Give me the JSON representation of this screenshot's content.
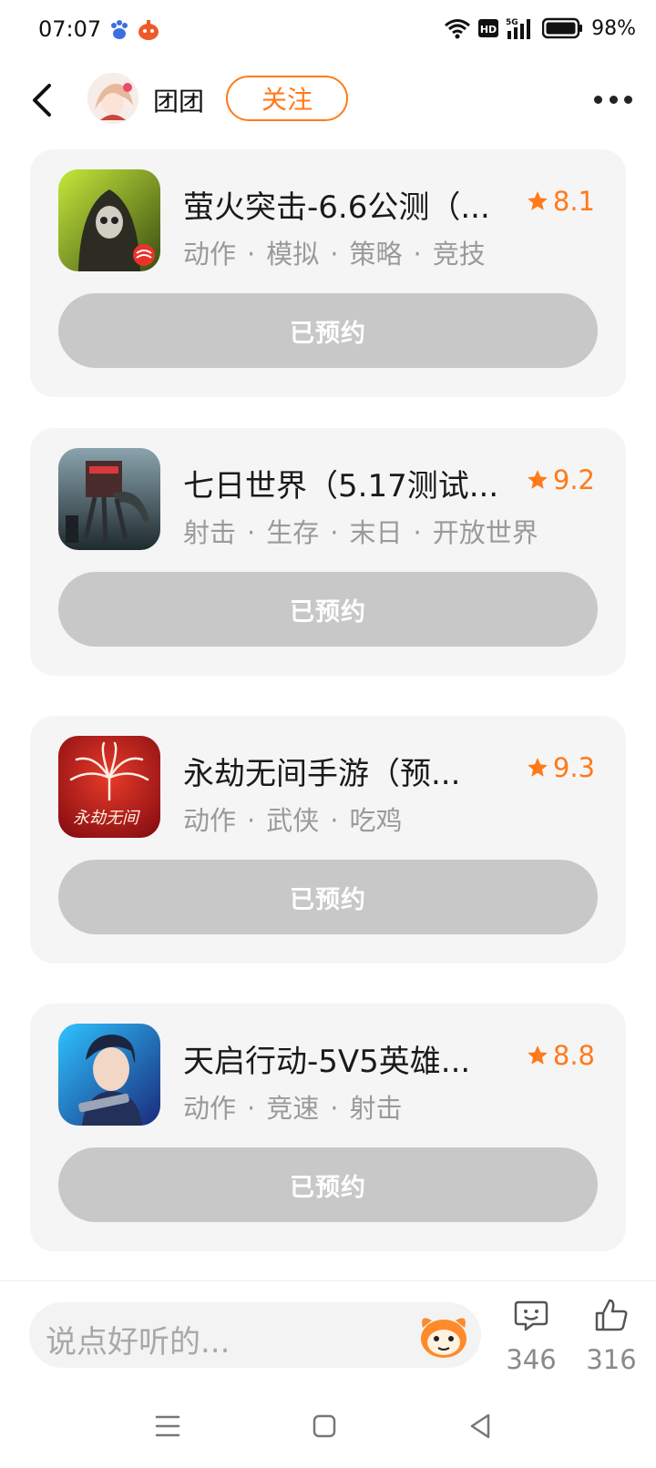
{
  "status_bar": {
    "time": "07:07",
    "battery": "98%",
    "hd_label": "HD",
    "net_label": "5G"
  },
  "header": {
    "username": "团团",
    "follow_label": "关注"
  },
  "games": [
    {
      "title": "萤火突击-6.6公测（...",
      "rating": "8.1",
      "tags": [
        "动作",
        "模拟",
        "策略",
        "竞技"
      ],
      "button": "已预约"
    },
    {
      "title": "七日世界（5.17测试...",
      "rating": "9.2",
      "tags": [
        "射击",
        "生存",
        "末日",
        "开放世界"
      ],
      "button": "已预约"
    },
    {
      "title": "永劫无间手游（预...",
      "rating": "9.3",
      "tags": [
        "动作",
        "武侠",
        "吃鸡"
      ],
      "button": "已预约"
    },
    {
      "title": "天启行动-5V5英雄...",
      "rating": "8.8",
      "tags": [
        "动作",
        "竞速",
        "射击"
      ],
      "button": "已预约"
    }
  ],
  "bottom": {
    "comment_placeholder": "说点好听的...",
    "comment_count": "346",
    "like_count": "316"
  },
  "colors": {
    "accent": "#ff7a1a",
    "reserved_button": "#c8c8c8",
    "card_bg": "#f5f5f5"
  }
}
